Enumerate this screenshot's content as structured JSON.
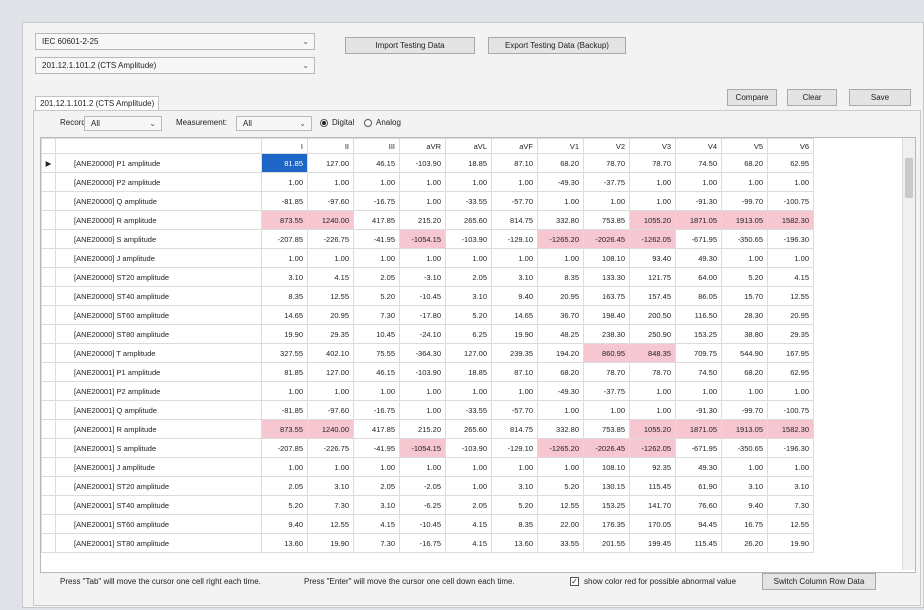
{
  "top": {
    "standard": "IEC 60601-2-25",
    "clause": "201.12.1.101.2 (CTS Amplitude)",
    "import_label": "Import Testing Data",
    "export_label": "Export Testing Data (Backup)"
  },
  "tab_label": "201.12.1.101.2 (CTS Amplitude)",
  "actions": {
    "compare": "Compare",
    "clear": "Clear",
    "save": "Save"
  },
  "filters": {
    "record_label": "Record:",
    "record_value": "All",
    "measurement_label": "Measurement:",
    "measurement_value": "All",
    "digital": "Digital",
    "analog": "Analog"
  },
  "grid": {
    "columns": [
      "I",
      "II",
      "III",
      "aVR",
      "aVL",
      "aVF",
      "V1",
      "V2",
      "V3",
      "V4",
      "V5",
      "V6"
    ],
    "rows": [
      {
        "name": "[ANE20000] P1 amplitude",
        "values": [
          "81.85",
          "127.00",
          "46.15",
          "-103.90",
          "18.85",
          "87.10",
          "68.20",
          "78.70",
          "78.70",
          "74.50",
          "68.20",
          "62.95"
        ]
      },
      {
        "name": "[ANE20000] P2 amplitude",
        "values": [
          "1.00",
          "1.00",
          "1.00",
          "1.00",
          "1.00",
          "1.00",
          "-49.30",
          "-37.75",
          "1.00",
          "1.00",
          "1.00",
          "1.00"
        ]
      },
      {
        "name": "[ANE20000] Q amplitude",
        "values": [
          "-81.85",
          "-97.60",
          "-16.75",
          "1.00",
          "-33.55",
          "-57.70",
          "1.00",
          "1.00",
          "1.00",
          "-91.30",
          "-99.70",
          "-100.75"
        ]
      },
      {
        "name": "[ANE20000] R amplitude",
        "values": [
          "873.55",
          "1240.00",
          "417.85",
          "215.20",
          "265.60",
          "814.75",
          "332.80",
          "753.85",
          "1055.20",
          "1871.05",
          "1913.05",
          "1582.30"
        ]
      },
      {
        "name": "[ANE20000] S amplitude",
        "values": [
          "-207.85",
          "-226.75",
          "-41.95",
          "-1054.15",
          "-103.90",
          "-129.10",
          "-1265.20",
          "-2026.45",
          "-1262.05",
          "-671.95",
          "-350.65",
          "-196.30"
        ]
      },
      {
        "name": "[ANE20000] J amplitude",
        "values": [
          "1.00",
          "1.00",
          "1.00",
          "1.00",
          "1.00",
          "1.00",
          "1.00",
          "108.10",
          "93.40",
          "49.30",
          "1.00",
          "1.00"
        ]
      },
      {
        "name": "[ANE20000] ST20 amplitude",
        "values": [
          "3.10",
          "4.15",
          "2.05",
          "-3.10",
          "2.05",
          "3.10",
          "8.35",
          "133.30",
          "121.75",
          "64.00",
          "5.20",
          "4.15"
        ]
      },
      {
        "name": "[ANE20000] ST40 amplitude",
        "values": [
          "8.35",
          "12.55",
          "5.20",
          "-10.45",
          "3.10",
          "9.40",
          "20.95",
          "163.75",
          "157.45",
          "86.05",
          "15.70",
          "12.55"
        ]
      },
      {
        "name": "[ANE20000] ST60 amplitude",
        "values": [
          "14.65",
          "20.95",
          "7.30",
          "-17.80",
          "5.20",
          "14.65",
          "36.70",
          "198.40",
          "200.50",
          "116.50",
          "28.30",
          "20.95"
        ]
      },
      {
        "name": "[ANE20000] ST80 amplitude",
        "values": [
          "19.90",
          "29.35",
          "10.45",
          "-24.10",
          "6.25",
          "19.90",
          "48.25",
          "238.30",
          "250.90",
          "153.25",
          "38.80",
          "29.35"
        ]
      },
      {
        "name": "[ANE20000] T amplitude",
        "values": [
          "327.55",
          "402.10",
          "75.55",
          "-364.30",
          "127.00",
          "239.35",
          "194.20",
          "860.95",
          "848.35",
          "709.75",
          "544.90",
          "167.95"
        ]
      },
      {
        "name": "[ANE20001] P1 amplitude",
        "values": [
          "81.85",
          "127.00",
          "46.15",
          "-103.90",
          "18.85",
          "87.10",
          "68.20",
          "78.70",
          "78.70",
          "74.50",
          "68.20",
          "62.95"
        ]
      },
      {
        "name": "[ANE20001] P2 amplitude",
        "values": [
          "1.00",
          "1.00",
          "1.00",
          "1.00",
          "1.00",
          "1.00",
          "-49.30",
          "-37.75",
          "1.00",
          "1.00",
          "1.00",
          "1.00"
        ]
      },
      {
        "name": "[ANE20001] Q amplitude",
        "values": [
          "-81.85",
          "-97.60",
          "-16.75",
          "1.00",
          "-33.55",
          "-57.70",
          "1.00",
          "1.00",
          "1.00",
          "-91.30",
          "-99.70",
          "-100.75"
        ]
      },
      {
        "name": "[ANE20001] R amplitude",
        "values": [
          "873.55",
          "1240.00",
          "417.85",
          "215.20",
          "265.60",
          "814.75",
          "332.80",
          "753.85",
          "1055.20",
          "1871.05",
          "1913.05",
          "1582.30"
        ]
      },
      {
        "name": "[ANE20001] S amplitude",
        "values": [
          "-207.85",
          "-226.75",
          "-41.95",
          "-1054.15",
          "-103.90",
          "-129.10",
          "-1265.20",
          "-2026.45",
          "-1262.05",
          "-671.95",
          "-350.65",
          "-196.30"
        ]
      },
      {
        "name": "[ANE20001] J amplitude",
        "values": [
          "1.00",
          "1.00",
          "1.00",
          "1.00",
          "1.00",
          "1.00",
          "1.00",
          "108.10",
          "92.35",
          "49.30",
          "1.00",
          "1.00"
        ]
      },
      {
        "name": "[ANE20001] ST20 amplitude",
        "values": [
          "2.05",
          "3.10",
          "2.05",
          "-2.05",
          "1.00",
          "3.10",
          "5.20",
          "130.15",
          "115.45",
          "61.90",
          "3.10",
          "3.10"
        ]
      },
      {
        "name": "[ANE20001] ST40 amplitude",
        "values": [
          "5.20",
          "7.30",
          "3.10",
          "-6.25",
          "2.05",
          "5.20",
          "12.55",
          "153.25",
          "141.70",
          "76.60",
          "9.40",
          "7.30"
        ]
      },
      {
        "name": "[ANE20001] ST60 amplitude",
        "values": [
          "9.40",
          "12.55",
          "4.15",
          "-10.45",
          "4.15",
          "8.35",
          "22.00",
          "176.35",
          "170.05",
          "94.45",
          "16.75",
          "12.55"
        ]
      },
      {
        "name": "[ANE20001] ST80 amplitude",
        "values": [
          "13.60",
          "19.90",
          "7.30",
          "-16.75",
          "4.15",
          "13.60",
          "33.55",
          "201.55",
          "199.45",
          "115.45",
          "26.20",
          "19.90"
        ]
      }
    ],
    "highlighted": [
      [
        3,
        0
      ],
      [
        3,
        1
      ],
      [
        3,
        8
      ],
      [
        3,
        9
      ],
      [
        3,
        10
      ],
      [
        3,
        11
      ],
      [
        4,
        3
      ],
      [
        4,
        6
      ],
      [
        4,
        7
      ],
      [
        4,
        8
      ],
      [
        10,
        7
      ],
      [
        10,
        8
      ],
      [
        14,
        0
      ],
      [
        14,
        1
      ],
      [
        14,
        8
      ],
      [
        14,
        9
      ],
      [
        14,
        10
      ],
      [
        14,
        11
      ],
      [
        15,
        3
      ],
      [
        15,
        6
      ],
      [
        15,
        7
      ],
      [
        15,
        8
      ]
    ],
    "selected": [
      0,
      0
    ]
  },
  "footer": {
    "tab_hint": "Press \"Tab\" will move the cursor one cell right each time.",
    "enter_hint": "Press \"Enter\" will move  the cursor one cell down each time.",
    "checkbox_label": "show color red for possible abnormal value",
    "switch_label": "Switch Column Row Data"
  },
  "colors": {
    "selected": "#1e66c6",
    "abnormal": "#f6c7d1"
  }
}
